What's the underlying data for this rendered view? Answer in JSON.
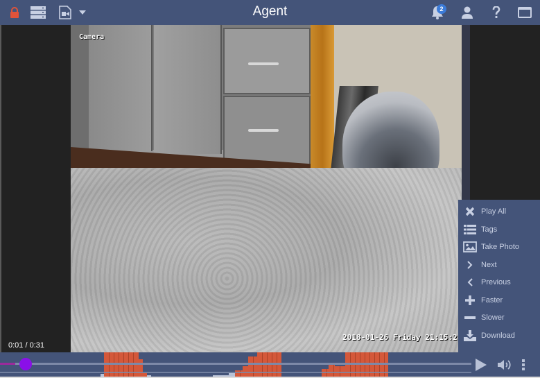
{
  "header": {
    "title": "Agent",
    "notification_count": "2",
    "icons": {
      "lock": "lock-icon",
      "servers": "server-list-icon",
      "video_file": "video-file-icon",
      "dropdown": "caret-down-icon",
      "notifications": "bell-icon",
      "user": "user-icon",
      "help": "question-icon",
      "window": "window-icon"
    },
    "colors": {
      "bar": "#445479",
      "lock": "#e0533a",
      "badge": "#3b7bd9"
    }
  },
  "video": {
    "camera_label": "Camera",
    "timestamp_overlay": "2018-01-26 Friday 21:15:2",
    "time_readout": "0:01 / 0:31"
  },
  "context_menu": {
    "items": [
      {
        "label": "Play All",
        "icon": "close-x-icon"
      },
      {
        "label": "Tags",
        "icon": "list-icon"
      },
      {
        "label": "Take Photo",
        "icon": "image-icon"
      },
      {
        "label": "Next",
        "icon": "chevron-right-icon"
      },
      {
        "label": "Previous",
        "icon": "chevron-left-icon"
      },
      {
        "label": "Faster",
        "icon": "plus-icon"
      },
      {
        "label": "Slower",
        "icon": "minus-icon"
      },
      {
        "label": "Download",
        "icon": "download-icon"
      }
    ]
  },
  "timeline": {
    "progress_fraction": 0.032,
    "controls": {
      "play": "play-icon",
      "volume": "volume-icon",
      "more": "more-vertical-icon"
    },
    "activity_color": "#d4583a",
    "activity_blocks": [
      {
        "start": 0.221,
        "end": 0.294,
        "level": 1.0
      },
      {
        "start": 0.294,
        "end": 0.303,
        "level": 0.72
      },
      {
        "start": 0.303,
        "end": 0.312,
        "level": 0.2
      },
      {
        "start": 0.499,
        "end": 0.514,
        "level": 0.3
      },
      {
        "start": 0.514,
        "end": 0.526,
        "level": 0.45
      },
      {
        "start": 0.526,
        "end": 0.545,
        "level": 0.85
      },
      {
        "start": 0.545,
        "end": 0.597,
        "level": 1.0
      },
      {
        "start": 0.683,
        "end": 0.697,
        "level": 0.35
      },
      {
        "start": 0.697,
        "end": 0.711,
        "level": 0.58
      },
      {
        "start": 0.711,
        "end": 0.732,
        "level": 0.45
      },
      {
        "start": 0.732,
        "end": 0.824,
        "level": 1.0
      }
    ],
    "grey_blocks": [
      {
        "start": 0.213,
        "end": 0.221,
        "level": 0.15
      },
      {
        "start": 0.312,
        "end": 0.321,
        "level": 0.12
      },
      {
        "start": 0.452,
        "end": 0.485,
        "level": 0.12
      },
      {
        "start": 0.485,
        "end": 0.499,
        "level": 0.2
      },
      {
        "start": 0.545,
        "end": 0.553,
        "level": 0.15
      },
      {
        "start": 0.634,
        "end": 0.649,
        "level": 0.06
      }
    ]
  }
}
